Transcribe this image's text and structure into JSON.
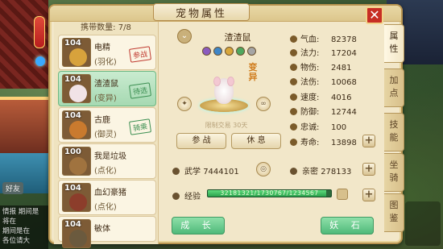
{
  "window": {
    "title": "宠物属性",
    "close_label": "✕"
  },
  "pet_list": {
    "count_label": "携带数量: 7/8",
    "items": [
      {
        "level": "104",
        "name": "电精",
        "type": "(羽化)",
        "status": "参战",
        "status_color": "red",
        "selected": false,
        "avatar_color": "#d7a23c"
      },
      {
        "level": "104",
        "name": "渣渣鼠",
        "type": "(变异)",
        "status": "待选",
        "status_color": "green",
        "selected": true,
        "avatar_color": "#f1e3e7"
      },
      {
        "level": "104",
        "name": "古鹿",
        "type": "(御灵)",
        "status": "骑乘",
        "status_color": "green",
        "selected": false,
        "avatar_color": "#c97a2e"
      },
      {
        "level": "100",
        "name": "我是垃圾",
        "type": "(点化)",
        "status": "",
        "status_color": "",
        "selected": false,
        "avatar_color": "#a0733f"
      },
      {
        "level": "104",
        "name": "血幻豪猪",
        "type": "(点化)",
        "status": "",
        "status_color": "",
        "selected": false,
        "avatar_color": "#8c3d2b"
      },
      {
        "level": "104",
        "name": "敏体",
        "type": "",
        "status": "",
        "status_color": "",
        "selected": false,
        "avatar_color": "#6b5a3e"
      }
    ]
  },
  "pet_detail": {
    "name": "渣渣鼠",
    "variant_badge": "变异",
    "trade_note": "限制交易 30天",
    "dot_colors": [
      "#8b5bbf",
      "#3f86c7",
      "#d8a73b",
      "#4fa85f",
      "#a5a5a5"
    ],
    "buttons": {
      "battle": "参 战",
      "rest": "休 息"
    },
    "martial": {
      "label": "武学",
      "value": "7444101"
    },
    "intimacy": {
      "label": "亲密",
      "value": "278133"
    },
    "exp": {
      "label": "经验",
      "value_text": "32181321/1730767/1234567",
      "fill_percent": 96
    },
    "bottom_buttons": {
      "grow": "成 长",
      "stone": "妖 石"
    }
  },
  "stats": [
    {
      "label": "气血:",
      "value": "82378",
      "has_plus": false
    },
    {
      "label": "法力:",
      "value": "17204",
      "has_plus": false
    },
    {
      "label": "物伤:",
      "value": "2481",
      "has_plus": false
    },
    {
      "label": "法伤:",
      "value": "10068",
      "has_plus": false
    },
    {
      "label": "速度:",
      "value": "4016",
      "has_plus": false
    },
    {
      "label": "防御:",
      "value": "12744",
      "has_plus": false
    },
    {
      "label": "忠诚:",
      "value": "100",
      "has_plus": false
    },
    {
      "label": "寿命:",
      "value": "13898",
      "has_plus": true
    }
  ],
  "tabs": [
    "属性",
    "加点",
    "技能",
    "坐骑",
    "图鉴"
  ],
  "background": {
    "chat_lines": [
      "情报  期间是",
      "将在",
      "期间是在",
      "各位请大"
    ],
    "friend_label": "好友"
  }
}
